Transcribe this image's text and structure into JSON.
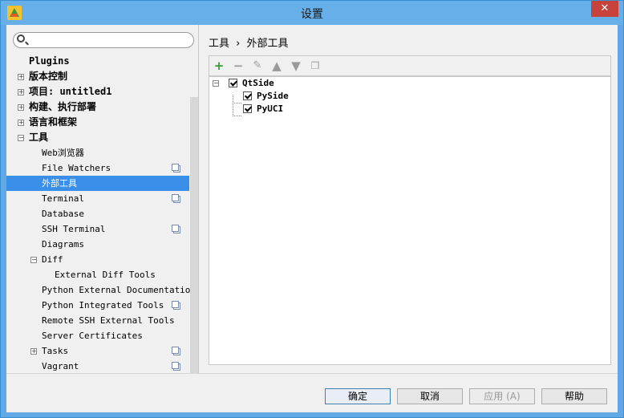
{
  "window": {
    "title": "设置",
    "close_glyph": "✕"
  },
  "search": {
    "placeholder": ""
  },
  "tree": [
    {
      "label": "Plugins",
      "level": 0,
      "expander": null
    },
    {
      "label": "版本控制",
      "level": 0,
      "expander": "+"
    },
    {
      "label": "项目: untitled1",
      "level": 0,
      "expander": "+"
    },
    {
      "label": "构建、执行部署",
      "level": 0,
      "expander": "+"
    },
    {
      "label": "语言和框架",
      "level": 0,
      "expander": "+"
    },
    {
      "label": "工具",
      "level": 0,
      "expander": "-"
    },
    {
      "label": "Web浏览器",
      "level": 1
    },
    {
      "label": "File Watchers",
      "level": 1,
      "copy": true
    },
    {
      "label": "外部工具",
      "level": 1,
      "selected": true
    },
    {
      "label": "Terminal",
      "level": 1,
      "copy": true
    },
    {
      "label": "Database",
      "level": 1
    },
    {
      "label": "SSH Terminal",
      "level": 1,
      "copy": true
    },
    {
      "label": "Diagrams",
      "level": 1
    },
    {
      "label": "Diff",
      "level": 1,
      "expander": "-"
    },
    {
      "label": "External Diff Tools",
      "level": 2
    },
    {
      "label": "Python External Documentation",
      "level": 1
    },
    {
      "label": "Python Integrated Tools",
      "level": 1,
      "copy": true
    },
    {
      "label": "Remote SSH External Tools",
      "level": 1
    },
    {
      "label": "Server Certificates",
      "level": 1
    },
    {
      "label": "Tasks",
      "level": 1,
      "expander": "+",
      "copy": true
    },
    {
      "label": "Vagrant",
      "level": 1,
      "copy": true
    }
  ],
  "breadcrumb": {
    "parent": "工具",
    "separator": "›",
    "current": "外部工具"
  },
  "toolbar": {
    "add": "+",
    "remove": "−",
    "edit": "✎",
    "up": "▲",
    "down": "▼",
    "copy": "❐"
  },
  "tools_list": [
    {
      "label": "QtSide",
      "checked": true,
      "group": true
    },
    {
      "label": "PySide",
      "checked": true
    },
    {
      "label": "PyUCI",
      "checked": true
    }
  ],
  "footer": {
    "ok": "确定",
    "cancel": "取消",
    "apply": "应用 (A)",
    "help": "帮助"
  },
  "colors": {
    "accent": "#3a8fe8",
    "titlebar": "#67afe8",
    "close": "#c7423a",
    "add_green": "#3a9a3a"
  }
}
